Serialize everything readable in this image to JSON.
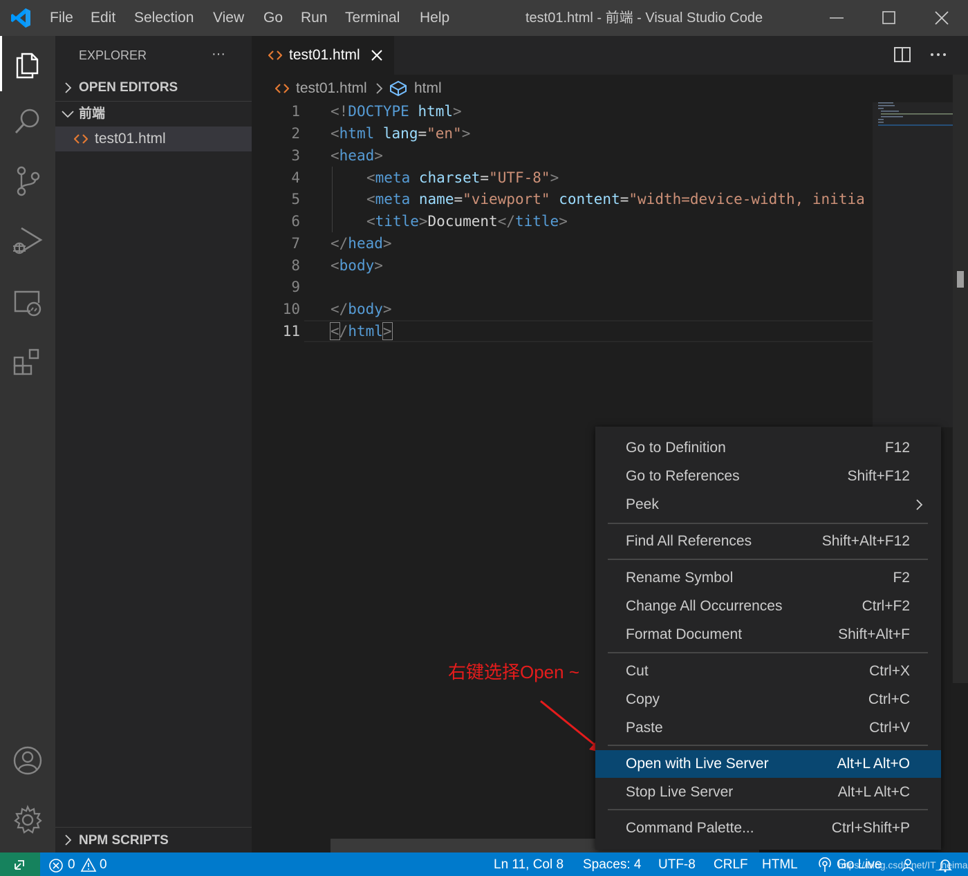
{
  "app": {
    "window_title": "test01.html - 前端 - Visual Studio Code",
    "menu": [
      "File",
      "Edit",
      "Selection",
      "View",
      "Go",
      "Run",
      "Terminal",
      "Help"
    ]
  },
  "activity_bar": {
    "icons": [
      "explorer-icon",
      "search-icon",
      "source-control-icon",
      "run-debug-icon",
      "remote-explorer-icon",
      "extensions-icon",
      "accounts-icon",
      "settings-gear-icon"
    ]
  },
  "sidebar": {
    "title": "EXPLORER",
    "more": "···",
    "open_editors": "OPEN EDITORS",
    "folder": "前端",
    "file": "test01.html",
    "npm_scripts": "NPM SCRIPTS"
  },
  "editor": {
    "tab_label": "test01.html",
    "breadcrumb_file": "test01.html",
    "breadcrumb_symbol": "html",
    "line_numbers": [
      "1",
      "2",
      "3",
      "4",
      "5",
      "6",
      "7",
      "8",
      "9",
      "10",
      "11"
    ],
    "code": {
      "l1": {
        "p1": "<!",
        "t1": "DOCTYPE",
        "sp": " ",
        "a1": "html",
        "p2": ">"
      },
      "l2": {
        "p1": "<",
        "t1": "html",
        "sp": " ",
        "a1": "lang",
        "w1": "=",
        "s1": "\"en\"",
        "p2": ">"
      },
      "l3": {
        "p1": "<",
        "t1": "head",
        "p2": ">"
      },
      "l4": {
        "p1": "<",
        "t1": "meta",
        "sp": " ",
        "a1": "charset",
        "w1": "=",
        "s1": "\"UTF-8\"",
        "p2": ">"
      },
      "l5": {
        "p1": "<",
        "t1": "meta",
        "sp": " ",
        "a1": "name",
        "w1": "=",
        "s1": "\"viewport\"",
        "sp2": " ",
        "a2": "content",
        "w2": "=",
        "s2": "\"width=device-width, initia"
      },
      "l6": {
        "p1": "<",
        "t1": "title",
        "p2": ">",
        "w1": "Document",
        "p3": "</",
        "t2": "title",
        "p4": ">"
      },
      "l7": {
        "p1": "</",
        "t1": "head",
        "p2": ">"
      },
      "l8": {
        "p1": "<",
        "t1": "body",
        "p2": ">"
      },
      "l10": {
        "p1": "</",
        "t1": "body",
        "p2": ">"
      },
      "l11": {
        "p1": "<",
        "p2": "/",
        "t1": "html",
        "p3": ">"
      }
    }
  },
  "context_menu": {
    "items": [
      {
        "label": "Go to Definition",
        "key": "F12"
      },
      {
        "label": "Go to References",
        "key": "Shift+F12"
      },
      {
        "label": "Peek",
        "key": ""
      },
      {
        "label": "Find All References",
        "key": "Shift+Alt+F12"
      },
      {
        "label": "Rename Symbol",
        "key": "F2"
      },
      {
        "label": "Change All Occurrences",
        "key": "Ctrl+F2"
      },
      {
        "label": "Format Document",
        "key": "Shift+Alt+F"
      },
      {
        "label": "Cut",
        "key": "Ctrl+X"
      },
      {
        "label": "Copy",
        "key": "Ctrl+C"
      },
      {
        "label": "Paste",
        "key": "Ctrl+V"
      },
      {
        "label": "Open with Live Server",
        "key": "Alt+L Alt+O"
      },
      {
        "label": "Stop Live Server",
        "key": "Alt+L Alt+C"
      },
      {
        "label": "Command Palette...",
        "key": "Ctrl+Shift+P"
      }
    ],
    "highlighted": "Open with Live Server"
  },
  "annotation": {
    "text": "右键选择Open ~",
    "color": "#e51c1c"
  },
  "status_bar": {
    "errors": "0",
    "warnings": "0",
    "position": "Ln 11, Col 8",
    "spaces": "Spaces: 4",
    "encoding": "UTF-8",
    "eol": "CRLF",
    "language": "HTML",
    "go_live": "Go Live",
    "watermark": "https://blog.csdn.net/IT_heima"
  },
  "colors": {
    "accent": "#007acc",
    "menu_highlight": "#094771",
    "tag": "#569cd6",
    "attr": "#9cdcfe",
    "string": "#ce9178"
  }
}
